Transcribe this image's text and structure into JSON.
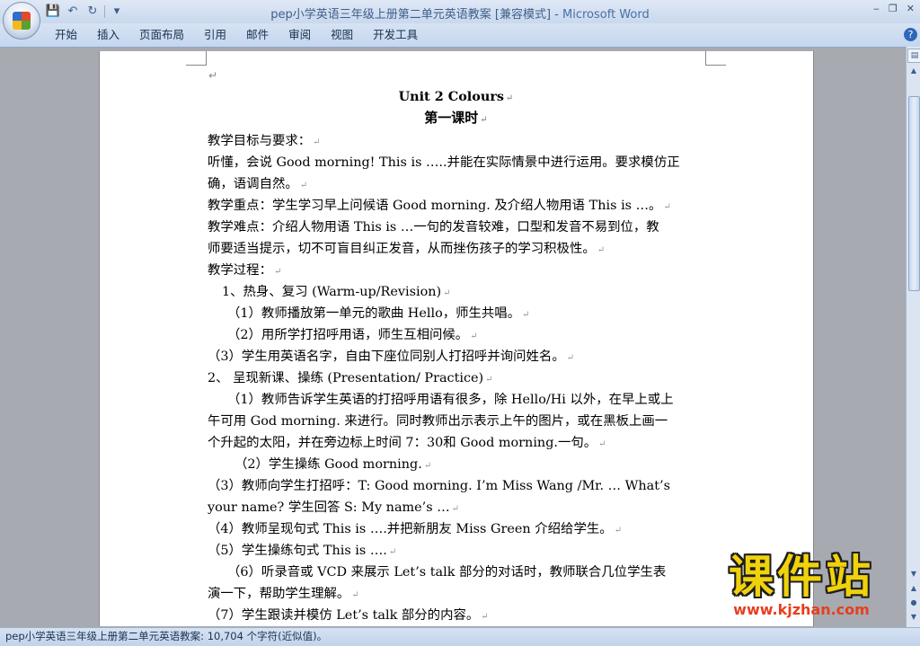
{
  "titlebar": {
    "doc_title": "pep小学英语三年级上册第二单元英语教案 [兼容模式] - ",
    "app_name": "Microsoft Word",
    "qat": {
      "save": "💾",
      "undo": "↶",
      "redo": "↻",
      "more": "▾"
    },
    "controls": {
      "minimize": "‒",
      "restore": "❐",
      "close": "✕"
    }
  },
  "ribbon": {
    "tabs": [
      "开始",
      "插入",
      "页面布局",
      "引用",
      "邮件",
      "审阅",
      "视图",
      "开发工具"
    ],
    "help": "?"
  },
  "document": {
    "paragraph_mark": "↵",
    "lines": [
      "",
      "Unit 2   Colours",
      "第一课时",
      "教学目标与要求：",
      "听懂，会说 Good morning! This is …..并能在实际情景中进行运用。要求模仿正",
      "确，语调自然。",
      "教学重点：学生学习早上问候语  Good morning. 及介绍人物用语  This is …。",
      "教学难点：介绍人物用语  This is …一句的发音较难，口型和发音不易到位，教",
      "师要适当提示，切不可盲目纠正发音，从而挫伤孩子的学习积极性。",
      "教学过程：",
      "1、热身、复习  (Warm-up/Revision)",
      "（1）教师播放第一单元的歌曲  Hello，师生共唱。",
      "（2）用所学打招呼用语，师生互相问候。",
      "（3）学生用英语名字，自由下座位同别人打招呼并询问姓名。",
      "2、 呈现新课、操练  (Presentation/ Practice)",
      "（1）教师告诉学生英语的打招呼用语有很多，除 Hello/Hi 以外，在早上或上",
      "午可用  God morning. 来进行。同时教师出示表示上午的图片，或在黑板上画一",
      "个升起的太阳，并在旁边标上时间 7：30和  Good morning.一句。",
      "（2）学生操练 Good morning.",
      "（3）教师向学生打招呼：T: Good morning. I’m Miss Wang /Mr. …     What’s",
      "your name? 学生回答  S: My name’s …",
      "（4）教师呈现句式 This is ….并把新朋友 Miss Green 介绍给学生。",
      "（5）学生操练句式 This is ….",
      "（6）听录音或 VCD 来展示 Let’s talk 部分的对话时，教师联合几位学生表",
      "演一下，帮助学生理解。",
      "（7）学生跟读并模仿 Let’s talk 部分的内容。"
    ]
  },
  "statusbar": {
    "text": "pep小学英语三年级上册第二单元英语教案: 10,704 个字符(近似值)。"
  },
  "watermark": {
    "main": "课件站",
    "url": "www.kjzhan.com"
  },
  "scrollbar": {
    "ruler_icon": "▤",
    "up": "▲",
    "down": "▼",
    "prev": "▲",
    "select": "●",
    "next": "▼"
  }
}
